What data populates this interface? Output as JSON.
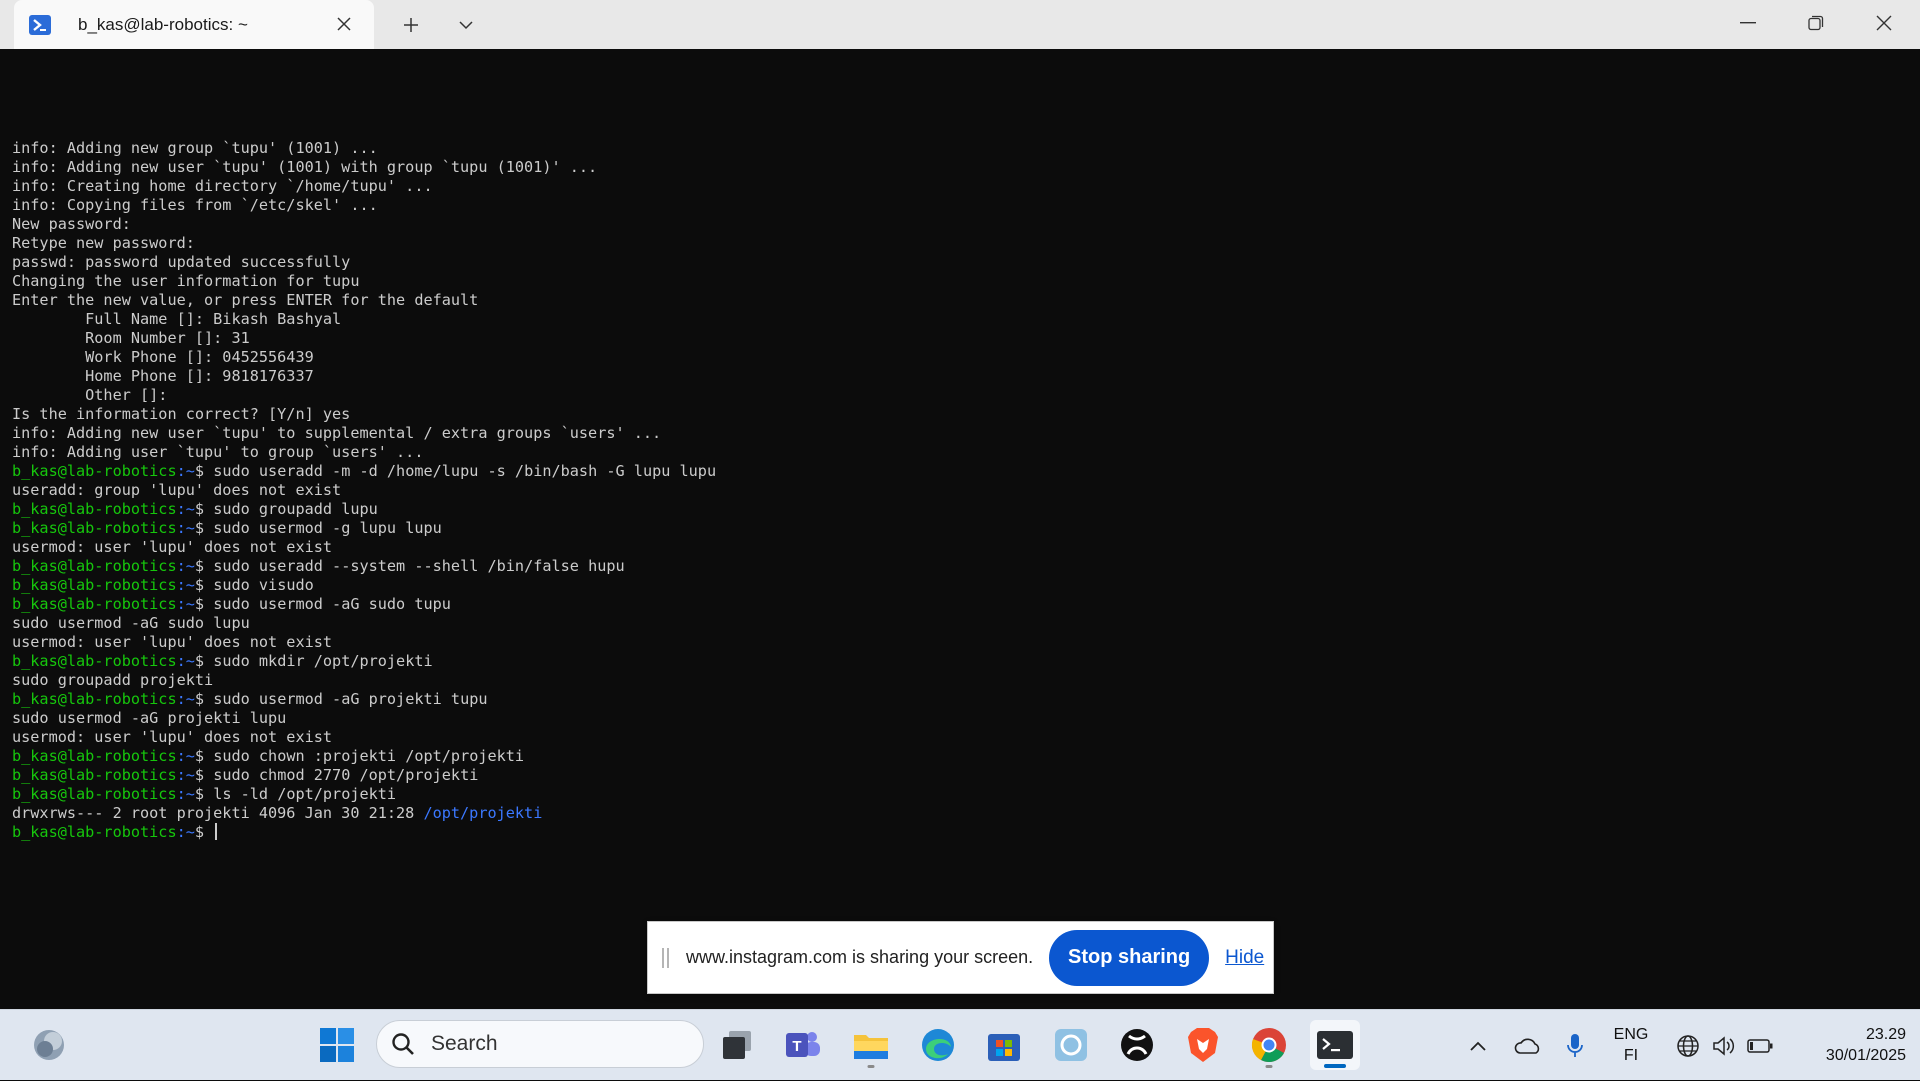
{
  "window": {
    "tab_title": "b_kas@lab-robotics: ~",
    "icons": {
      "tab": "powershell-terminal-icon",
      "close_tab": "close-icon",
      "new_tab": "plus-icon",
      "dropdown": "chevron-down-icon",
      "minimize": "minimize-icon",
      "maximize": "restore-icon",
      "close": "close-icon"
    }
  },
  "terminal": {
    "prompt_user": "b_kas@lab-robotics",
    "prompt_path": ":~",
    "prompt_symbol": "$ ",
    "lines": [
      {
        "kind": "out",
        "text": "info: Adding new group `tupu' (1001) ..."
      },
      {
        "kind": "out",
        "text": "info: Adding new user `tupu' (1001) with group `tupu (1001)' ..."
      },
      {
        "kind": "out",
        "text": "info: Creating home directory `/home/tupu' ..."
      },
      {
        "kind": "out",
        "text": "info: Copying files from `/etc/skel' ..."
      },
      {
        "kind": "out",
        "text": "New password:"
      },
      {
        "kind": "out",
        "text": "Retype new password:"
      },
      {
        "kind": "out",
        "text": "passwd: password updated successfully"
      },
      {
        "kind": "out",
        "text": "Changing the user information for tupu"
      },
      {
        "kind": "out",
        "text": "Enter the new value, or press ENTER for the default"
      },
      {
        "kind": "out",
        "text": "        Full Name []: Bikash Bashyal"
      },
      {
        "kind": "out",
        "text": "        Room Number []: 31"
      },
      {
        "kind": "out",
        "text": "        Work Phone []: 0452556439"
      },
      {
        "kind": "out",
        "text": "        Home Phone []: 9818176337"
      },
      {
        "kind": "out",
        "text": "        Other []:"
      },
      {
        "kind": "out",
        "text": "Is the information correct? [Y/n] yes"
      },
      {
        "kind": "out",
        "text": "info: Adding new user `tupu' to supplemental / extra groups `users' ..."
      },
      {
        "kind": "out",
        "text": "info: Adding user `tupu' to group `users' ..."
      },
      {
        "kind": "cmd",
        "text": "sudo useradd -m -d /home/lupu -s /bin/bash -G lupu lupu"
      },
      {
        "kind": "out",
        "text": "useradd: group 'lupu' does not exist"
      },
      {
        "kind": "cmd",
        "text": "sudo groupadd lupu"
      },
      {
        "kind": "cmd",
        "text": "sudo usermod -g lupu lupu"
      },
      {
        "kind": "out",
        "text": "usermod: user 'lupu' does not exist"
      },
      {
        "kind": "cmd",
        "text": "sudo useradd --system --shell /bin/false hupu"
      },
      {
        "kind": "cmd",
        "text": "sudo visudo"
      },
      {
        "kind": "cmd",
        "text": "sudo usermod -aG sudo tupu"
      },
      {
        "kind": "out",
        "text": "sudo usermod -aG sudo lupu"
      },
      {
        "kind": "out",
        "text": "usermod: user 'lupu' does not exist"
      },
      {
        "kind": "cmd",
        "text": "sudo mkdir /opt/projekti"
      },
      {
        "kind": "out",
        "text": "sudo groupadd projekti"
      },
      {
        "kind": "cmd",
        "text": "sudo usermod -aG projekti tupu"
      },
      {
        "kind": "out",
        "text": "sudo usermod -aG projekti lupu"
      },
      {
        "kind": "out",
        "text": "usermod: user 'lupu' does not exist"
      },
      {
        "kind": "cmd",
        "text": "sudo chown :projekti /opt/projekti"
      },
      {
        "kind": "cmd",
        "text": "sudo chmod 2770 /opt/projekti"
      },
      {
        "kind": "cmd",
        "text": "ls -ld /opt/projekti"
      },
      {
        "kind": "ls",
        "text": "drwxrws--- 2 root projekti 4096 Jan 30 21:28 ",
        "link": "/opt/projekti"
      },
      {
        "kind": "cmd",
        "text": "",
        "cursor": true
      }
    ]
  },
  "share_banner": {
    "message": "www.instagram.com is sharing your screen.",
    "stop_label": "Stop sharing",
    "hide_label": "Hide",
    "colors": {
      "button": "#0b57d0"
    }
  },
  "taskbar": {
    "search_label": "Search",
    "apps": [
      "widgets-icon",
      "start-icon",
      "task-view-icon",
      "teams-icon",
      "file-explorer-icon",
      "edge-icon",
      "microsoft-store-icon",
      "app-icon",
      "xbox-icon",
      "brave-icon",
      "chrome-icon",
      "terminal-icon"
    ],
    "tray": {
      "language_top": "ENG",
      "language_bottom": "FI",
      "time": "23.29",
      "date": "30/01/2025"
    }
  },
  "colors": {
    "terminal_bg": "#0c0c0c",
    "terminal_fg": "#cccccc",
    "prompt_user": "#16c60c",
    "prompt_path": "#3b78ff"
  }
}
